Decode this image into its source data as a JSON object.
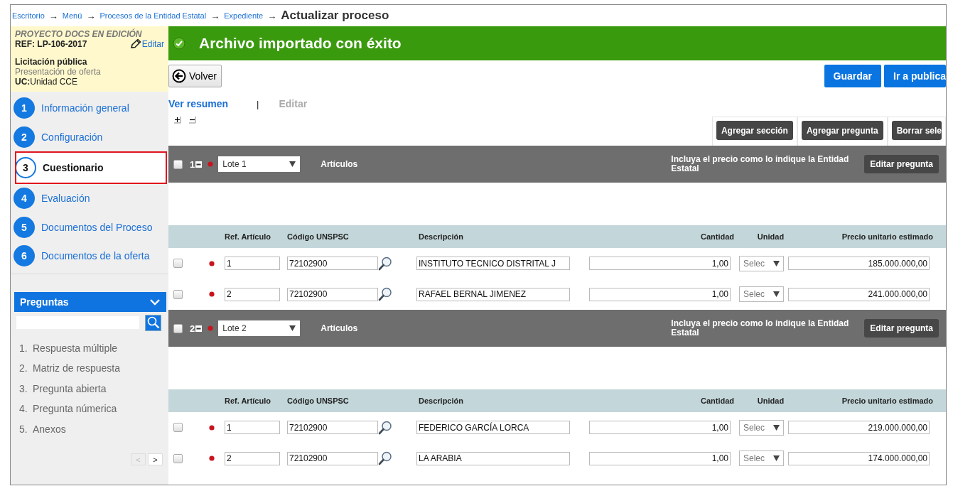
{
  "breadcrumb": [
    {
      "kind": "link",
      "label": "Escritorio"
    },
    {
      "kind": "arrow",
      "label": "→"
    },
    {
      "kind": "link",
      "label": "Menú"
    },
    {
      "kind": "arrow",
      "label": "→"
    },
    {
      "kind": "link",
      "label": "Procesos de la Entidad Estatal"
    },
    {
      "kind": "arrow",
      "label": "→"
    },
    {
      "kind": "link",
      "label": "Expediente"
    },
    {
      "kind": "arrow",
      "label": "→"
    },
    {
      "kind": "current",
      "label": "Actualizar proceso"
    }
  ],
  "project": {
    "status": "PROYECTO DOCS EN EDICIÓN",
    "ref": "REF: LP-106-2017",
    "edit_link": "Editar",
    "type": "Licitación pública",
    "phase": "Presentación de oferta",
    "unit": "**UC:**Unidad CCE"
  },
  "steps": [
    {
      "number": "1",
      "label": "Información general",
      "selected": false
    },
    {
      "number": "2",
      "label": "Configuración",
      "selected": false
    },
    {
      "number": "3",
      "label": "Cuestionario",
      "selected": true
    },
    {
      "number": "4",
      "label": "Evaluación",
      "selected": false
    },
    {
      "number": "5",
      "label": "Documentos del Proceso",
      "selected": false
    },
    {
      "number": "6",
      "label": "Documentos de la oferta",
      "selected": false
    }
  ],
  "questions_panel": {
    "title": "Preguntas",
    "expanded": true,
    "items": [
      {
        "number": "1.",
        "label": "Respuesta múltiple"
      },
      {
        "number": "2.",
        "label": "Matriz de respuesta"
      },
      {
        "number": "3.",
        "label": "Pregunta abierta"
      },
      {
        "number": "4.",
        "label": "Pregunta númerica"
      },
      {
        "number": "5.",
        "label": "Anexos"
      }
    ],
    "pager": [
      {
        "label": "<",
        "disabled": true
      },
      {
        "label": ">",
        "disabled": false
      }
    ]
  },
  "banner": {
    "message": "Archivo importado con éxito"
  },
  "back_button": "Volver",
  "top_buttons": [
    "Guardar",
    "Ir a publica"
  ],
  "view_tabs": [
    {
      "label": "Ver resumen",
      "selected": true
    },
    {
      "label": "Editar",
      "selected": false
    }
  ],
  "tab_separator": "|",
  "toolbar": [
    "Agregar sección",
    "Agregar pregunta",
    "Borrar sele"
  ],
  "sections": [
    {
      "number": "1",
      "checked": false,
      "lot": "Lote 1",
      "type_label": "Artículos",
      "instruction": "Incluya el precio como lo indique la Entidad Estatal",
      "edit_button": "Editar pregunta",
      "columns": [
        "Ref. Artículo",
        "Código UNSPSC",
        "Descripción",
        "Cantidad",
        "Unidad",
        "Precio unitario estimado"
      ],
      "rows": [
        {
          "checked": false,
          "ref": "1",
          "code": "72102900",
          "description": "INSTITUTO TECNICO DISTRITAL J",
          "quantity": "1,00",
          "unit": "Selec",
          "price": "185.000.000,00"
        },
        {
          "checked": false,
          "ref": "2",
          "code": "72102900",
          "description": "RAFAEL BERNAL JIMENEZ",
          "quantity": "1,00",
          "unit": "Selec",
          "price": "241.000.000,00"
        }
      ]
    },
    {
      "number": "2",
      "checked": false,
      "lot": "Lote 2",
      "type_label": "Artículos",
      "instruction": "Incluya el precio como lo indique la Entidad Estatal",
      "edit_button": "Editar pregunta",
      "columns": [
        "Ref. Artículo",
        "Código UNSPSC",
        "Descripción",
        "Cantidad",
        "Unidad",
        "Precio unitario estimado"
      ],
      "rows": [
        {
          "checked": false,
          "ref": "1",
          "code": "72102900",
          "description": "FEDERICO GARCÍA LORCA",
          "quantity": "1,00",
          "unit": "Selec",
          "price": "219.000.000,00"
        },
        {
          "checked": false,
          "ref": "2",
          "code": "72102900",
          "description": "LA ARABIA",
          "quantity": "1,00",
          "unit": "Selec",
          "price": "174.000.000,00"
        }
      ]
    }
  ]
}
